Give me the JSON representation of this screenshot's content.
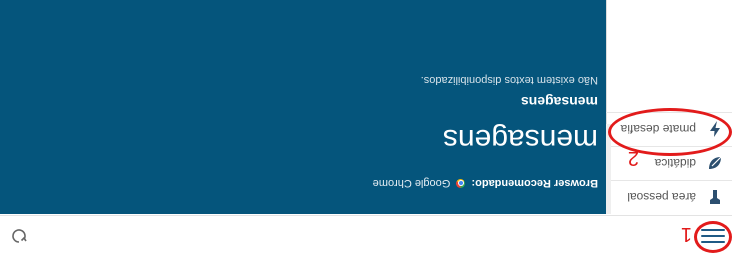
{
  "header": {
    "menu_icon": "hamburger-menu-icon",
    "refresh_icon": "refresh-icon"
  },
  "sidebar": {
    "items": [
      {
        "label": "área pessoal",
        "icon": "person-icon"
      },
      {
        "label": "didática",
        "icon": "leaf-icon"
      },
      {
        "label": "pmate desafia",
        "icon": "lightning-icon"
      }
    ]
  },
  "main": {
    "browser_label": "Browser Recomendado:",
    "browser_name": "Google Chrome",
    "title": "mensagens",
    "subtitle": "mensagens",
    "empty_note": "Não existem textos disponibilizados."
  },
  "annotations": {
    "one": "1",
    "two": "2",
    "color": "#e21b1b"
  },
  "colors": {
    "panel": "#05557c",
    "accent": "#1f5a85"
  }
}
